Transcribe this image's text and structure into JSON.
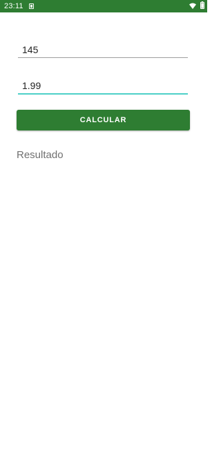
{
  "status_bar": {
    "time": "23:11",
    "background": "#2e7d32",
    "icons": [
      "notification-icon",
      "wifi-icon",
      "battery-icon"
    ]
  },
  "form": {
    "first_value": "145",
    "second_value": "1.99",
    "button_label": "CALCULAR",
    "result_label": "Resultado"
  },
  "colors": {
    "primary": "#2e7d32",
    "focus_underline": "#4dd0c8",
    "underline": "#9e9e9e",
    "result_text": "#707070"
  }
}
